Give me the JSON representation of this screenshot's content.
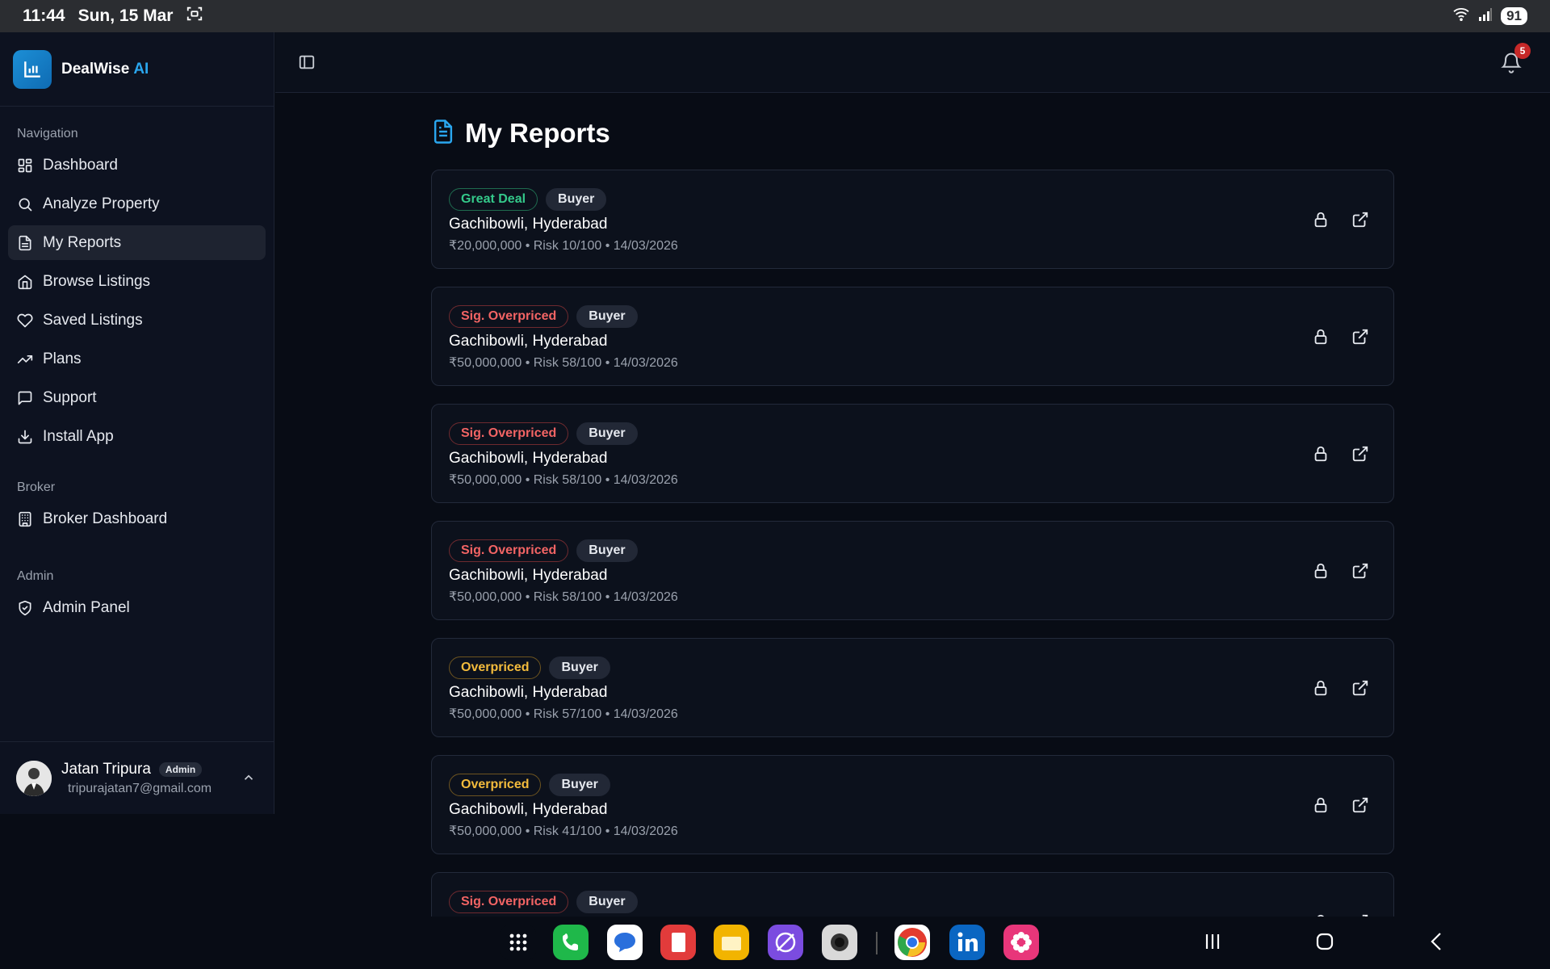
{
  "status_bar": {
    "time": "11:44",
    "date": "Sun, 15 Mar",
    "battery": "91"
  },
  "brand": {
    "name": "DealWise",
    "accent": "AI"
  },
  "sidebar": {
    "sections": [
      {
        "label": "Navigation",
        "items": [
          {
            "label": "Dashboard",
            "icon": "dashboard-icon"
          },
          {
            "label": "Analyze Property",
            "icon": "search-icon"
          },
          {
            "label": "My Reports",
            "icon": "document-icon",
            "active": true
          },
          {
            "label": "Browse Listings",
            "icon": "home-icon"
          },
          {
            "label": "Saved Listings",
            "icon": "heart-icon"
          },
          {
            "label": "Plans",
            "icon": "trending-up-icon"
          },
          {
            "label": "Support",
            "icon": "message-icon"
          },
          {
            "label": "Install App",
            "icon": "download-icon"
          }
        ]
      },
      {
        "label": "Broker",
        "items": [
          {
            "label": "Broker Dashboard",
            "icon": "building-icon"
          }
        ]
      },
      {
        "label": "Admin",
        "items": [
          {
            "label": "Admin Panel",
            "icon": "shield-check-icon"
          }
        ]
      }
    ]
  },
  "user": {
    "name": "Jatan Tripura",
    "role": "Admin",
    "email": "tripurajatan7@gmail.com"
  },
  "header": {
    "notification_count": "5"
  },
  "page": {
    "title": "My Reports"
  },
  "reports": [
    {
      "status": "Great Deal",
      "status_kind": "great",
      "role": "Buyer",
      "location": "Gachibowli, Hyderabad",
      "meta": "₹20,000,000 • Risk 10/100 • 14/03/2026"
    },
    {
      "status": "Sig. Overpriced",
      "status_kind": "sig",
      "role": "Buyer",
      "location": "Gachibowli, Hyderabad",
      "meta": "₹50,000,000 • Risk 58/100 • 14/03/2026"
    },
    {
      "status": "Sig. Overpriced",
      "status_kind": "sig",
      "role": "Buyer",
      "location": "Gachibowli, Hyderabad",
      "meta": "₹50,000,000 • Risk 58/100 • 14/03/2026"
    },
    {
      "status": "Sig. Overpriced",
      "status_kind": "sig",
      "role": "Buyer",
      "location": "Gachibowli, Hyderabad",
      "meta": "₹50,000,000 • Risk 58/100 • 14/03/2026"
    },
    {
      "status": "Overpriced",
      "status_kind": "over",
      "role": "Buyer",
      "location": "Gachibowli, Hyderabad",
      "meta": "₹50,000,000 • Risk 57/100 • 14/03/2026"
    },
    {
      "status": "Overpriced",
      "status_kind": "over",
      "role": "Buyer",
      "location": "Gachibowli, Hyderabad",
      "meta": "₹50,000,000 • Risk 41/100 • 14/03/2026"
    },
    {
      "status": "Sig. Overpriced",
      "status_kind": "sig",
      "role": "Buyer",
      "location": "",
      "meta": ""
    }
  ],
  "dock": {
    "apps": [
      {
        "icon": "app-drawer-icon",
        "color": "#080c15"
      },
      {
        "icon": "phone-icon",
        "color": "#1fb84a"
      },
      {
        "icon": "messages-icon",
        "color": "#ffffff"
      },
      {
        "icon": "notes-icon",
        "color": "#e23b3b"
      },
      {
        "icon": "files-icon",
        "color": "#f2b400"
      },
      {
        "icon": "browser-icon",
        "color": "#7b4ce0"
      },
      {
        "icon": "camera-icon",
        "color": "#d9d9d9"
      },
      {
        "icon": "chrome-icon",
        "color": "#ffffff"
      },
      {
        "icon": "linkedin-icon",
        "color": "#0a66c2"
      },
      {
        "icon": "gallery-icon",
        "color": "#e8367a"
      }
    ]
  }
}
